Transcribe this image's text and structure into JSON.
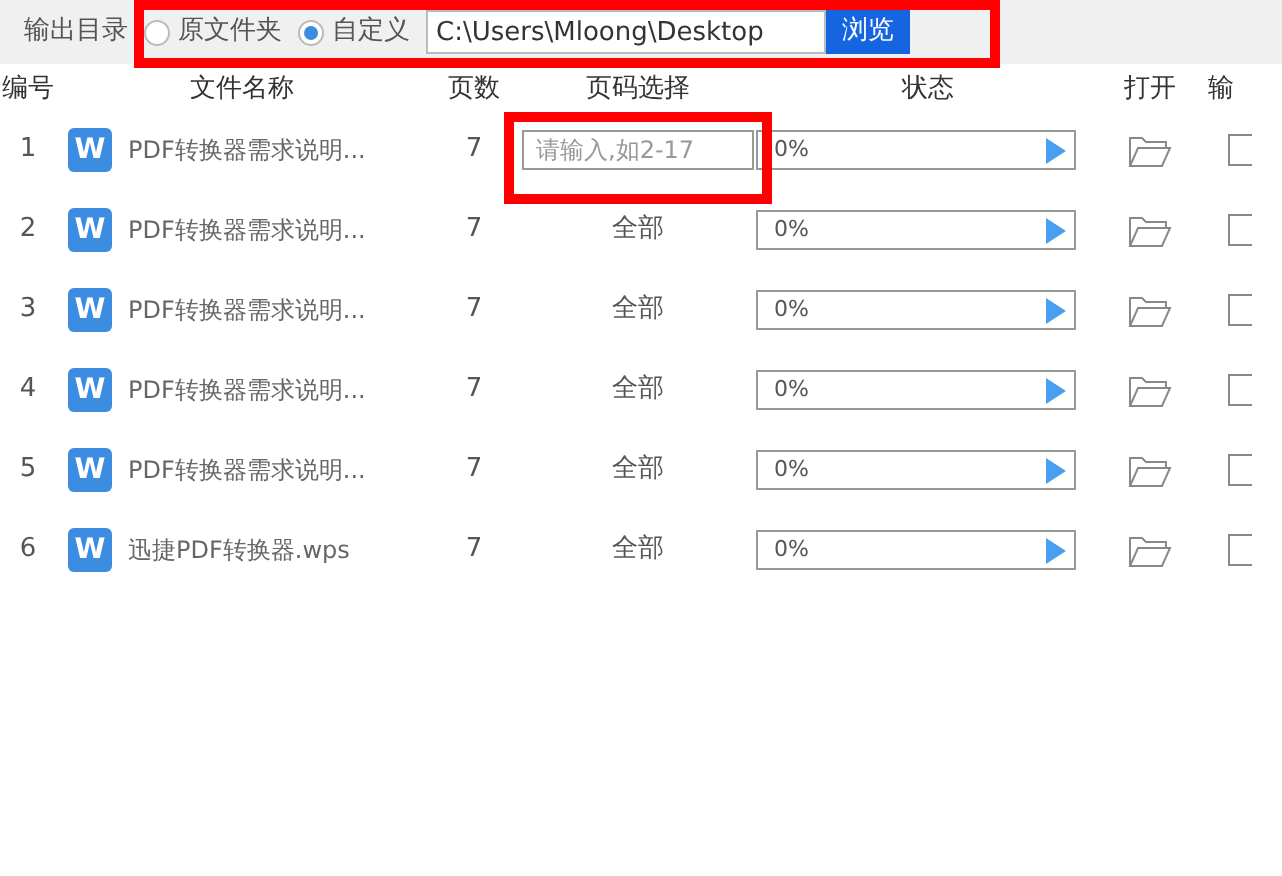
{
  "toolbar": {
    "label": "输出目录",
    "radios": [
      {
        "label": "原文件夹",
        "selected": false
      },
      {
        "label": "自定义",
        "selected": true
      }
    ],
    "path": "C:\\Users\\Mloong\\Desktop",
    "browse_button": "浏览"
  },
  "table": {
    "columns": [
      "编号",
      "文件名称",
      "页数",
      "页码选择",
      "状态",
      "打开",
      "输"
    ],
    "rows": [
      {
        "number": "1",
        "icon_letter": "W",
        "name": "PDF转换器需求说明...",
        "pages": "7",
        "page_range": {
          "kind": "input",
          "placeholder": "请输入,如2-17"
        },
        "status": {
          "text": "0%",
          "level": 0
        }
      },
      {
        "number": "2",
        "icon_letter": "W",
        "name": "PDF转换器需求说明...",
        "pages": "7",
        "page_range": {
          "kind": "text",
          "text": "全部"
        },
        "status": {
          "text": "0%",
          "level": 0
        }
      },
      {
        "number": "3",
        "icon_letter": "W",
        "name": "PDF转换器需求说明...",
        "pages": "7",
        "page_range": {
          "kind": "text",
          "text": "全部"
        },
        "status": {
          "text": "0%",
          "level": 0
        }
      },
      {
        "number": "4",
        "icon_letter": "W",
        "name": "PDF转换器需求说明...",
        "pages": "7",
        "page_range": {
          "kind": "text",
          "text": "全部"
        },
        "status": {
          "text": "0%",
          "level": 0
        }
      },
      {
        "number": "5",
        "icon_letter": "W",
        "name": "PDF转换器需求说明...",
        "pages": "7",
        "page_range": {
          "kind": "text",
          "text": "全部"
        },
        "status": {
          "text": "0%",
          "level": 0
        }
      },
      {
        "number": "6",
        "icon_letter": "W",
        "name": "迅捷PDF转换器.wps",
        "pages": "7",
        "page_range": {
          "kind": "text",
          "text": "全部"
        },
        "status": {
          "text": "0%",
          "level": 0
        }
      }
    ]
  }
}
